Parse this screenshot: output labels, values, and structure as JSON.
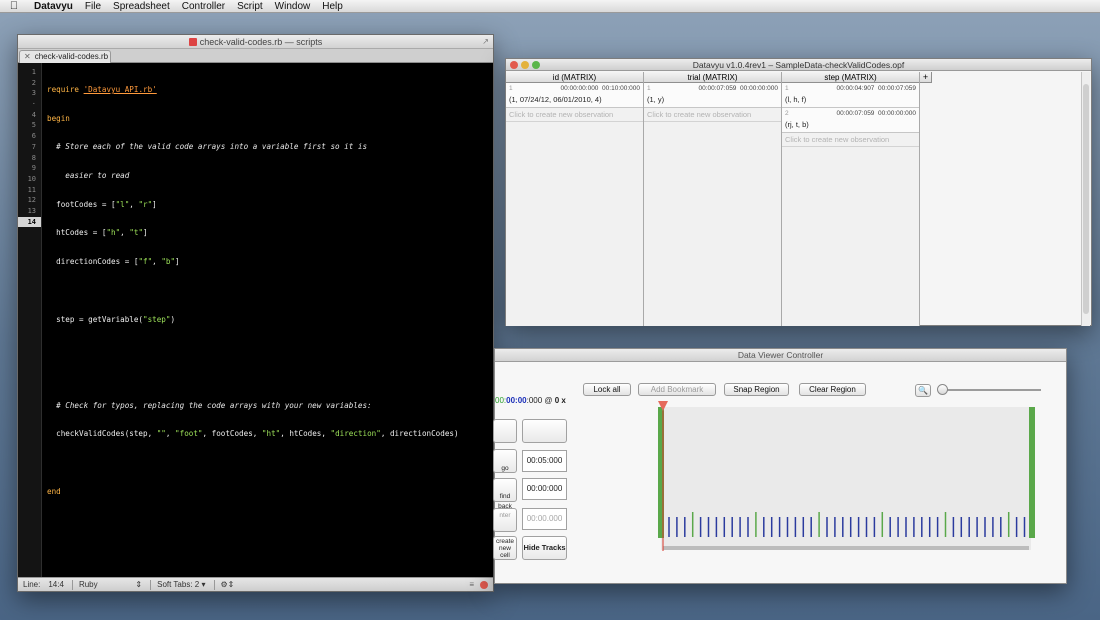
{
  "menubar": {
    "app": "Datavyu",
    "items": [
      "File",
      "Spreadsheet",
      "Controller",
      "Script",
      "Window",
      "Help"
    ]
  },
  "editor": {
    "title": "check-valid-codes.rb — scripts",
    "tab": "check-valid-codes.rb",
    "line_numbers": [
      "1",
      "2",
      "3",
      "·",
      "4",
      "5",
      "6",
      "7",
      "8",
      "9",
      "10",
      "11",
      "12",
      "13",
      "14"
    ],
    "current_line": "14",
    "status": {
      "line_label": "Line:",
      "position": "14:4",
      "language": "Ruby",
      "soft_tabs": "Soft Tabs:",
      "tab_size": "2"
    }
  },
  "code": {
    "l1_kw": "require",
    "l1_str": "'Datavyu_API.rb'",
    "l2_kw": "begin",
    "l3": "  # Store each of the valid code arrays into a variable first so it is",
    "l3b": "    easier to read",
    "l4_a": "  footCodes = [",
    "l4_s1": "\"l\"",
    "l4_b": ", ",
    "l4_s2": "\"r\"",
    "l4_c": "]",
    "l5_a": "  htCodes = [",
    "l5_s1": "\"h\"",
    "l5_b": ", ",
    "l5_s2": "\"t\"",
    "l5_c": "]",
    "l6_a": "  directionCodes = [",
    "l6_s1": "\"f\"",
    "l6_b": ", ",
    "l6_s2": "\"b\"",
    "l6_c": "]",
    "l8_a": "  step = getVariable(",
    "l8_s": "\"step\"",
    "l8_b": ")",
    "l11": "  # Check for typos, replacing the code arrays with your new variables:",
    "l12_a": "  checkValidCodes(step, ",
    "l12_s1": "\"\"",
    "l12_b": ", ",
    "l12_s2": "\"foot\"",
    "l12_c": ", footCodes, ",
    "l12_s3": "\"ht\"",
    "l12_d": ", htCodes, ",
    "l12_s4": "\"direction\"",
    "l12_e": ", directionCodes)",
    "l14_kw": "end"
  },
  "spreadsheet": {
    "title": "Datavyu v1.0.4rev1 – SampleData-checkValidCodes.opf",
    "add_column": "+",
    "new_observation": "Click to create new observation",
    "columns": [
      {
        "header": "id  (MATRIX)",
        "cells": [
          {
            "ord": "1",
            "onset": "00:00:00:000",
            "offset": "00:10:00:000",
            "value": "(1, 07/24/12, 06/01/2010, 4)"
          }
        ]
      },
      {
        "header": "trial  (MATRIX)",
        "cells": [
          {
            "ord": "1",
            "onset": "00:00:07:059",
            "offset": "00:00:00:000",
            "value": "(1, y)"
          }
        ]
      },
      {
        "header": "step  (MATRIX)",
        "cells": [
          {
            "ord": "1",
            "onset": "00:00:04:907",
            "offset": "00:00:07:059",
            "value": "(l, h, f)"
          },
          {
            "ord": "2",
            "onset": "00:00:07:059",
            "offset": "00:00:00:000",
            "value": "(rj, t, b)"
          }
        ]
      }
    ]
  },
  "controller": {
    "title": "Data Viewer Controller",
    "buttons": {
      "lock_all": "Lock all",
      "add_bookmark": "Add Bookmark",
      "snap_region": "Snap Region",
      "clear_region": "Clear Region",
      "hide_tracks": "Hide Tracks"
    },
    "timecode": {
      "green": "00:",
      "blue": "00:00",
      "rest": ":000 @ ",
      "rate": "0 x"
    },
    "small_buttons": {
      "go_back": "go back",
      "find": "find",
      "enter": "nter",
      "create_cell": "create\nnew\ncell"
    },
    "fields": {
      "go_back_time": "00:05:000",
      "find_time": "00:00:000",
      "enter_time": "00:00.000"
    },
    "track_colors": {
      "green": "#5aa84a",
      "blue": "#2b3b9e",
      "red": "#d8372b"
    }
  }
}
